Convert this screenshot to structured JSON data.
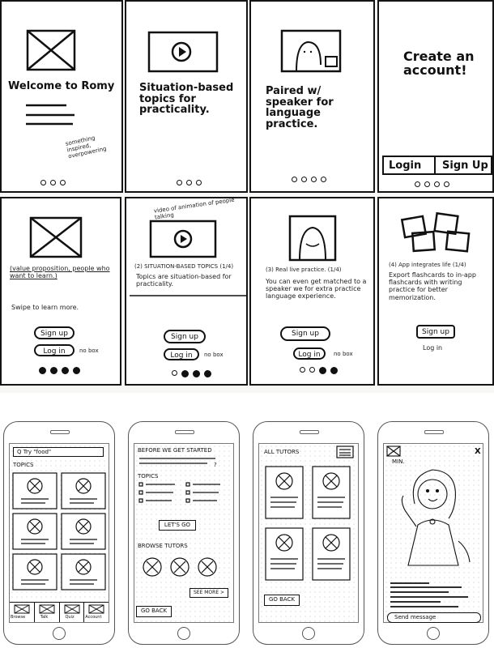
{
  "paper": {
    "panel1": {
      "title": "Welcome to Romy",
      "note": "something inspired, overpowering"
    },
    "panel2": {
      "title": "Situation-based topics for practicality."
    },
    "panel3": {
      "title": "Paired w/ speaker for language practice."
    },
    "panel4": {
      "title": "Create an account!",
      "login": "Login",
      "signup": "Sign Up"
    },
    "panel5": {
      "caption": "(value proposition, people who want to learn.)",
      "sub": "Swipe to learn more.",
      "signup": "Sign up",
      "login": "Log in",
      "note": "no box"
    },
    "panel6": {
      "annotation": "video of animation of people talking",
      "heading": "(2) SITUATION-BASED TOPICS (1/4)",
      "body": "Topics are situation-based for practicality.",
      "signup": "Sign up",
      "login": "Log in",
      "note": "no box"
    },
    "panel7": {
      "heading": "(3) Real live practice. (1/4)",
      "body": "You can even get matched to a speaker we for extra practice language experience.",
      "signup": "Sign up",
      "login": "Log in",
      "note": "no box"
    },
    "panel8": {
      "heading": "(4) App integrates life (1/4)",
      "body": "Export flashcards to in-app flashcards with writing practice for better memorization.",
      "signup": "Sign up",
      "login": "Log in"
    }
  },
  "phones": {
    "screen1": {
      "search": "Q Try \"food\"",
      "topics_label": "TOPICS",
      "tabs": [
        "Browse",
        "Talk",
        "Quiz",
        "Account"
      ]
    },
    "screen2": {
      "title": "BEFORE WE GET STARTED",
      "question_mark": "?",
      "topics_label": "TOPICS",
      "cta": "LET'S GO",
      "browse_label": "BROWSE TUTORS",
      "see_more": "SEE MORE >",
      "back": "GO BACK"
    },
    "screen3": {
      "title": "ALL TUTORS",
      "back": "GO BACK"
    },
    "screen4": {
      "min_label": "MIN.",
      "close": "X",
      "message_placeholder": "Send message"
    }
  }
}
